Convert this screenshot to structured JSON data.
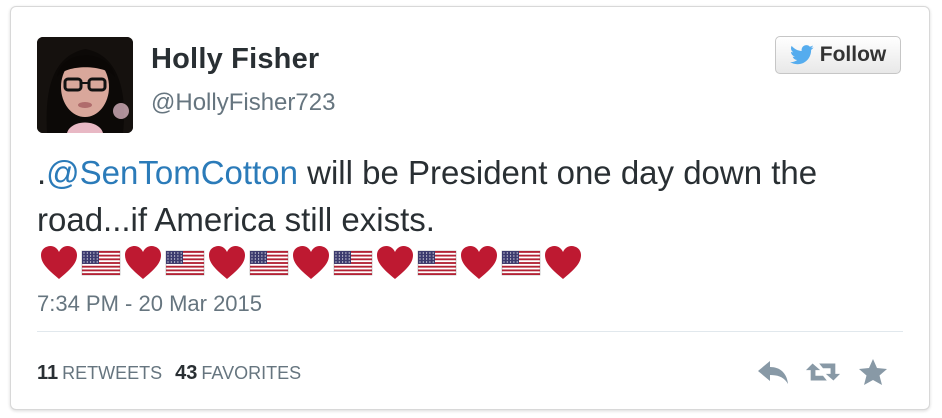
{
  "tweet": {
    "author": {
      "display_name": "Holly Fisher",
      "handle": "@HollyFisher723"
    },
    "follow_label": "Follow",
    "text": {
      "prefix": ".",
      "mention": "@SenTomCotton",
      "body": " will be President one day down the road...if America still exists."
    },
    "emoji_sequence": [
      "heart",
      "us-flag",
      "heart",
      "us-flag",
      "heart",
      "us-flag",
      "heart",
      "us-flag",
      "heart",
      "us-flag",
      "heart",
      "us-flag",
      "heart"
    ],
    "timestamp": "7:34 PM - 20 Mar 2015",
    "stats": {
      "retweets_count": "11",
      "retweets_label": "Retweets",
      "favorites_count": "43",
      "favorites_label": "Favorites"
    },
    "actions": [
      "reply-icon",
      "retweet-icon",
      "favorite-icon"
    ]
  },
  "colors": {
    "link": "#2b7bb9",
    "text": "#292f33",
    "muted": "#66757f",
    "heart": "#be1931",
    "twitter_bird": "#55acee"
  }
}
